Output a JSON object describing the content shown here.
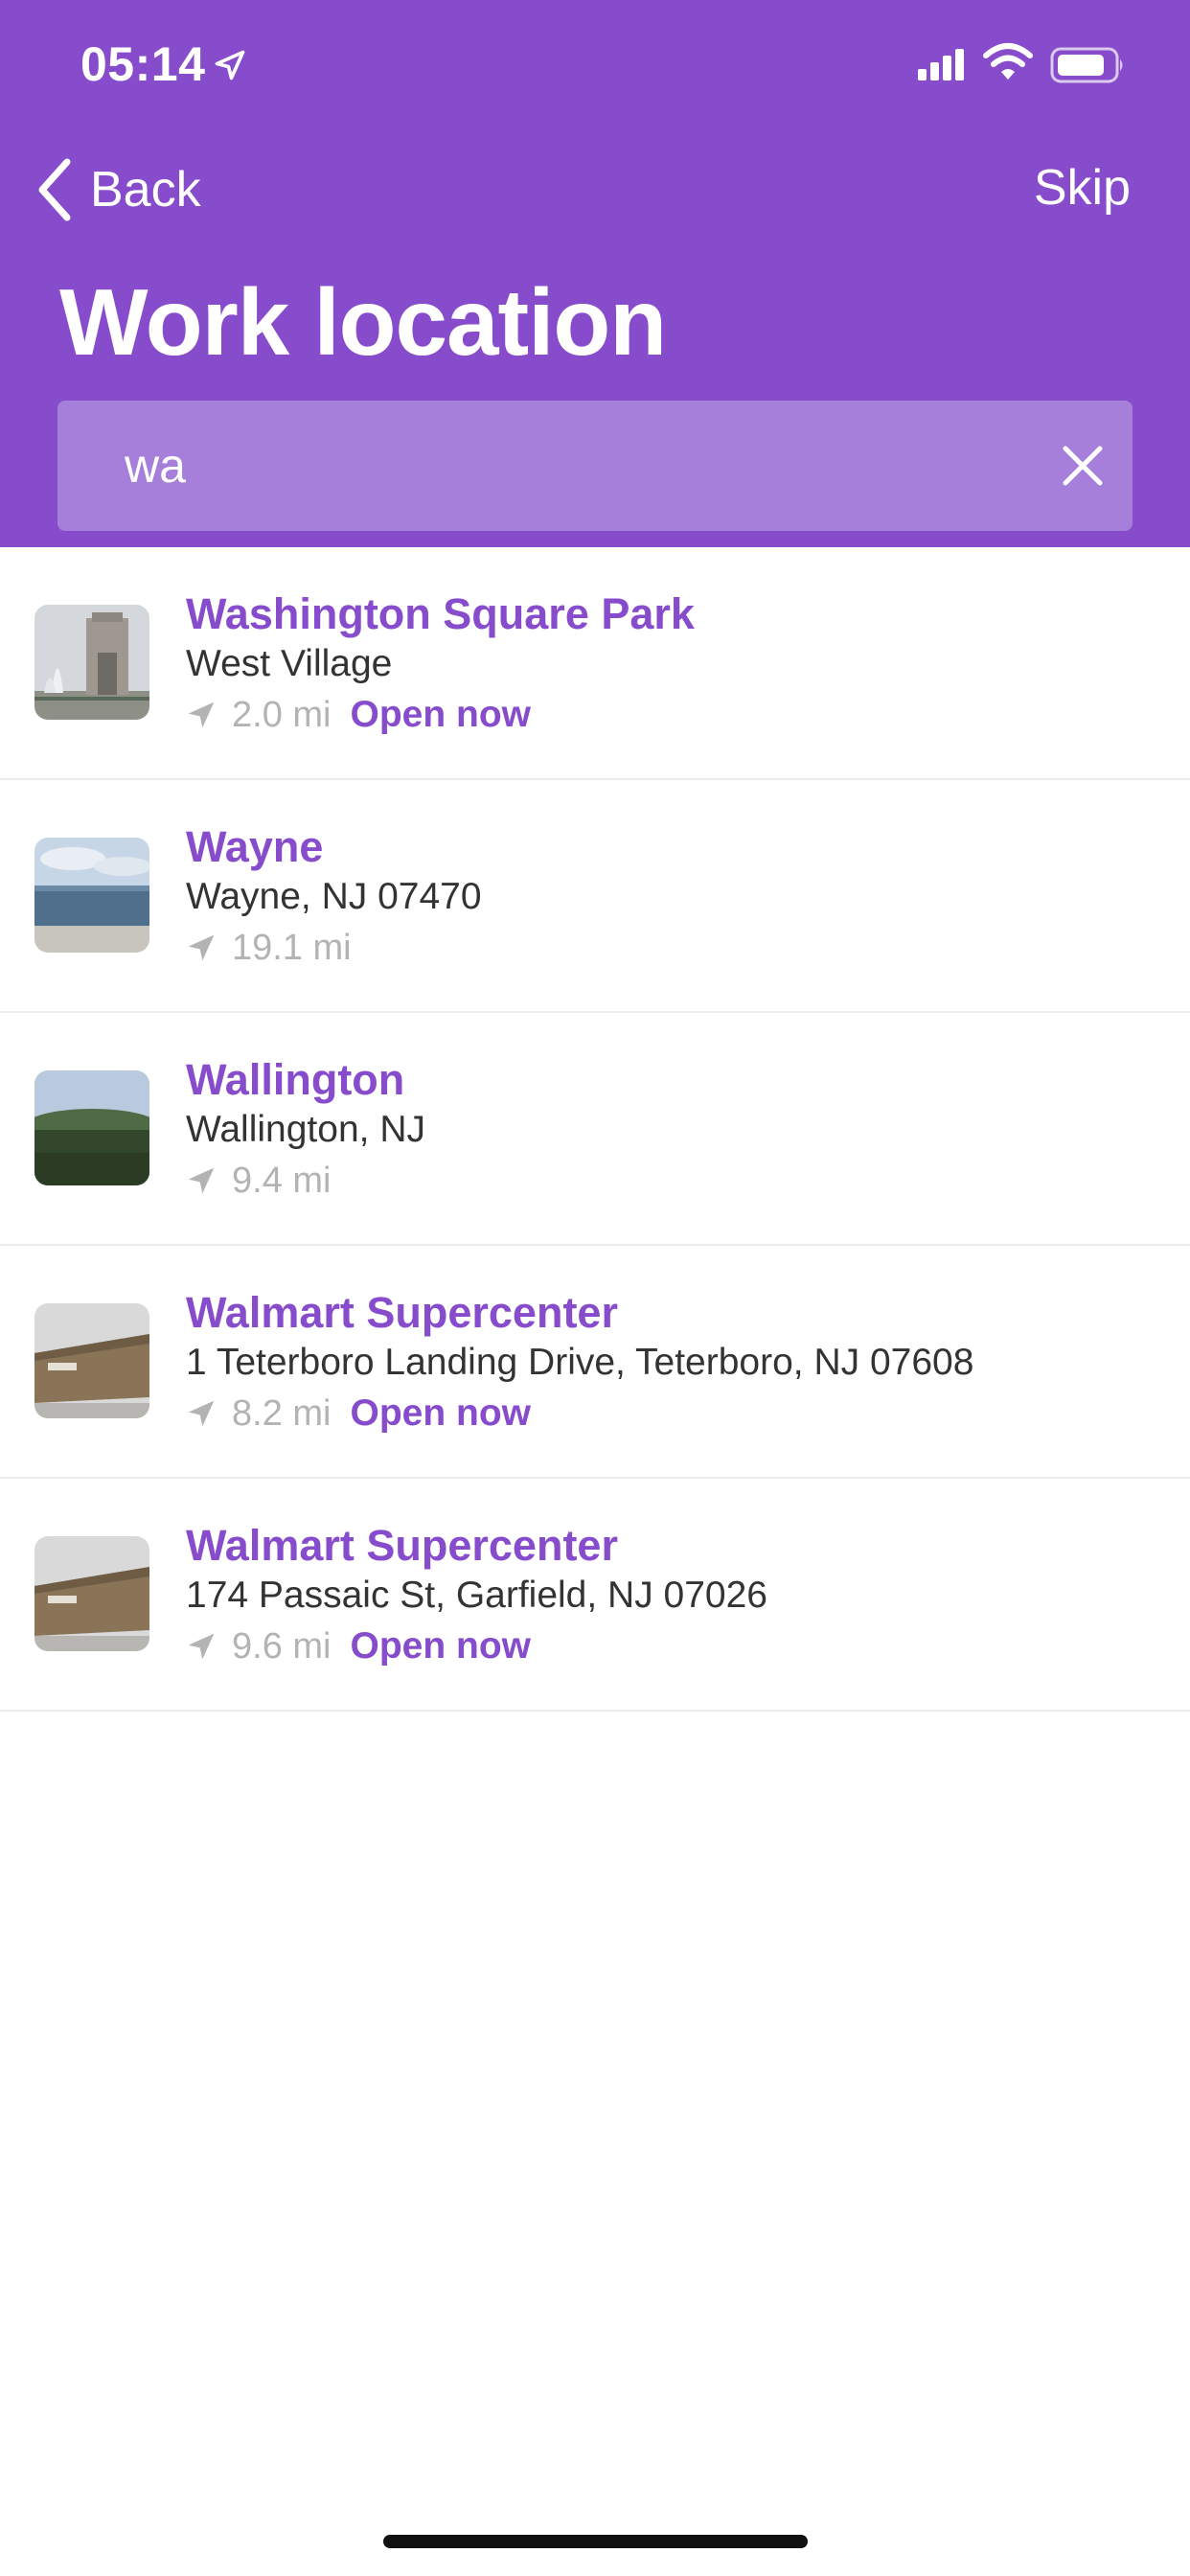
{
  "status_bar": {
    "time": "05:14",
    "icons": [
      "location-arrow-icon",
      "signal-icon",
      "wifi-icon",
      "battery-icon"
    ]
  },
  "nav": {
    "back_label": "Back",
    "skip_label": "Skip"
  },
  "page_title": "Work location",
  "search": {
    "value": "wa",
    "clear_icon": "close-icon"
  },
  "results": [
    {
      "name": "Washington Square Park",
      "address": "West Village",
      "distance": "2.0 mi",
      "status": "Open now"
    },
    {
      "name": "Wayne",
      "address": "Wayne, NJ 07470",
      "distance": "19.1 mi",
      "status": ""
    },
    {
      "name": "Wallington",
      "address": "Wallington, NJ",
      "distance": "9.4 mi",
      "status": ""
    },
    {
      "name": "Walmart Supercenter",
      "address": "1 Teterboro Landing Drive, Teterboro, NJ 07608",
      "distance": "8.2 mi",
      "status": "Open now"
    },
    {
      "name": "Walmart Supercenter",
      "address": "174 Passaic St, Garfield, NJ 07026",
      "distance": "9.6 mi",
      "status": "Open now"
    }
  ],
  "colors": {
    "accent": "#874ccc",
    "search_field": "#a57fd9",
    "secondary_text": "#b3b3b3"
  }
}
